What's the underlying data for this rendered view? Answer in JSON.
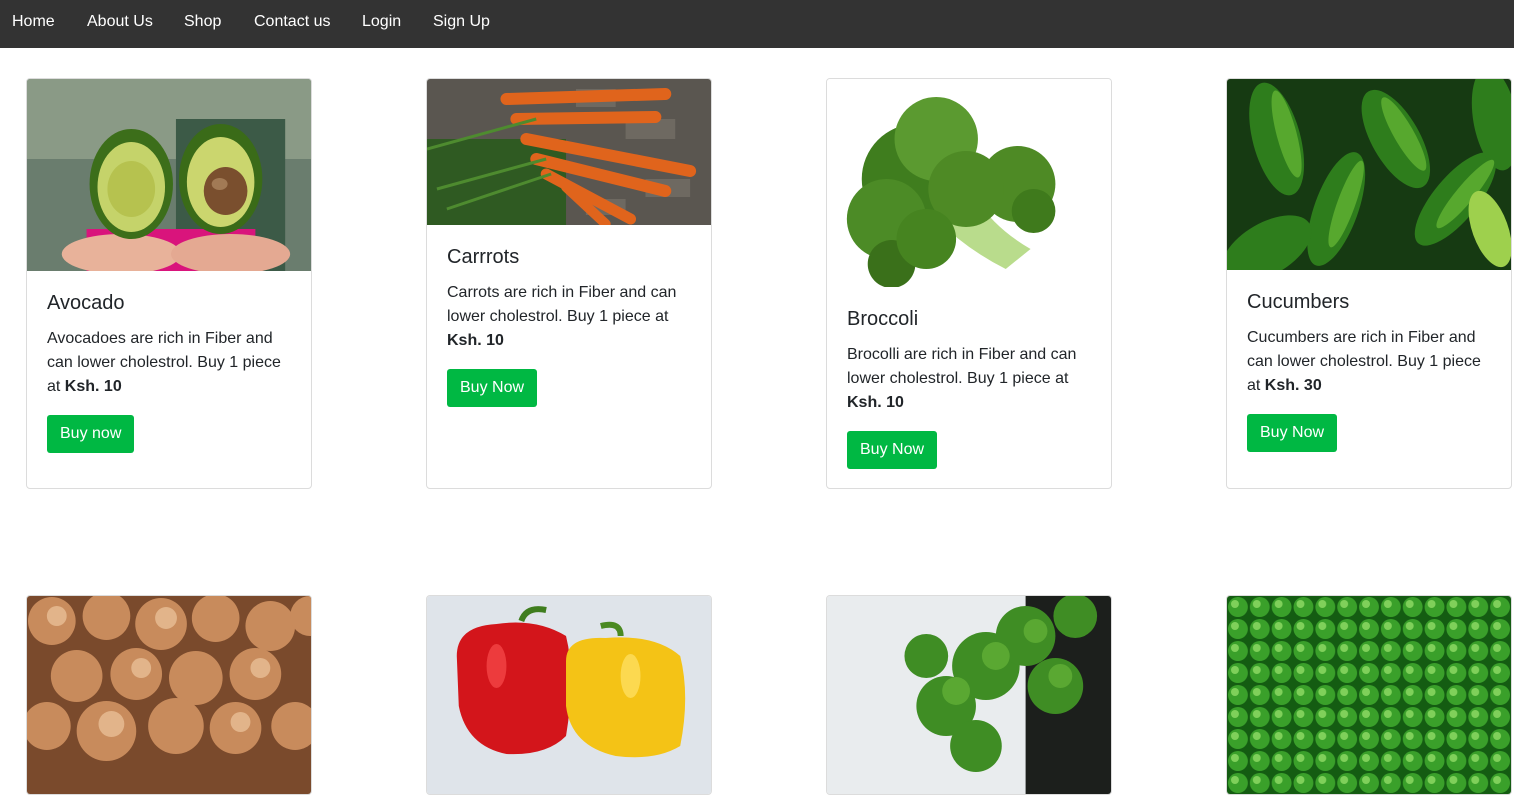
{
  "nav": {
    "items": [
      "Home",
      "About Us",
      "Shop",
      "Contact us",
      "Login",
      "Sign Up"
    ]
  },
  "products": [
    {
      "name": "Avocado",
      "desc": "Avocadoes are rich in Fiber and can lower cholestrol. Buy 1 piece at",
      "price": "Ksh. 10",
      "button": "Buy now"
    },
    {
      "name": "Carrrots",
      "desc": "Carrots are rich in Fiber and can lower cholestrol. Buy 1 piece at",
      "price": "Ksh. 10",
      "button": "Buy Now"
    },
    {
      "name": "Broccoli",
      "desc": "Brocolli are rich in Fiber and can lower cholestrol. Buy 1 piece at",
      "price": "Ksh. 10",
      "button": "Buy Now"
    },
    {
      "name": "Cucumbers",
      "desc": "Cucumbers are rich in Fiber and can lower cholestrol. Buy 1 piece at",
      "price": "Ksh. 30",
      "button": "Buy Now"
    }
  ],
  "colors": {
    "navbar": "#333333",
    "button": "#00b843"
  }
}
